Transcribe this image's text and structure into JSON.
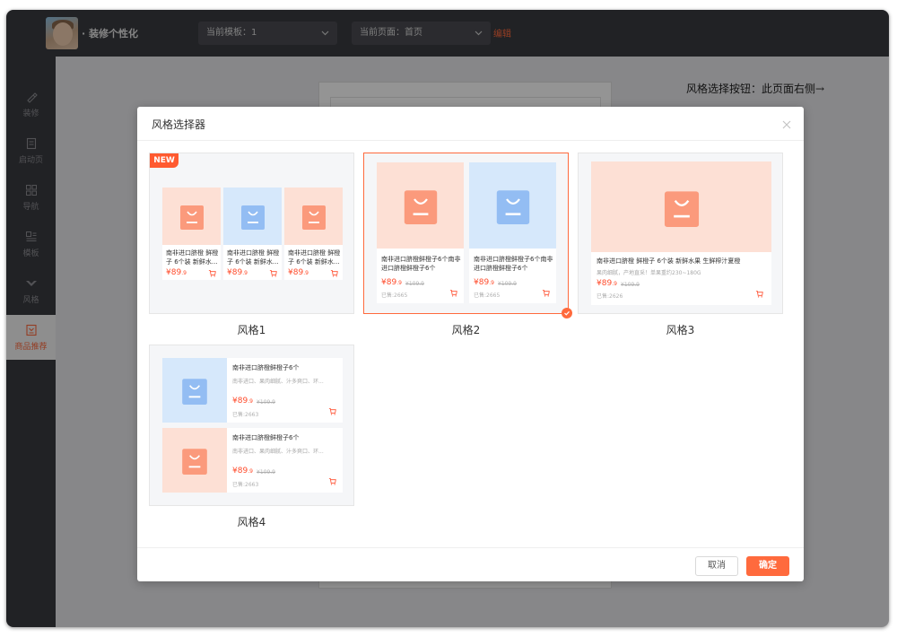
{
  "app": {
    "title": "· 装修个性化",
    "template_dropdown": "当前模板：1",
    "page_dropdown": "当前页面：首页",
    "edit_link": "编辑"
  },
  "sidebar": {
    "items": [
      {
        "label": "装修",
        "icon": "brush-icon"
      },
      {
        "label": "启动页",
        "icon": "document-icon"
      },
      {
        "label": "导航",
        "icon": "grid-icon"
      },
      {
        "label": "模板",
        "icon": "template-icon"
      },
      {
        "label": "风格",
        "icon": "style-icon"
      },
      {
        "label": "商品推荐",
        "icon": "recommend-icon",
        "active": true
      }
    ]
  },
  "hint_text": "风格选择按钮：此页面右侧→",
  "modal": {
    "title": "风格选择器",
    "cancel_label": "取消",
    "ok_label": "确定",
    "new_badge": "NEW",
    "styles": [
      {
        "label": "风格1"
      },
      {
        "label": "风格2",
        "selected": true
      },
      {
        "label": "风格3"
      },
      {
        "label": "风格4"
      }
    ]
  },
  "products": {
    "s1_name": "南非进口脐橙 鲜橙子 6个装 新鲜水...",
    "s2_name": "南非进口脐橙鲜橙子6个南非进口脐橙鲜橙子6个",
    "s3_name": "南非进口脐橙 鲜橙子 6个装 新鲜水果 生鲜榨汁夏橙",
    "s3_desc": "果肉细腻，产地直采！单果重约230~180G",
    "s4_name": "南非进口脐橙鲜橙子6个",
    "s4_desc": "南非进口、果肉细腻、汁多爽口、环...",
    "price_main": "¥89",
    "price_dec": ".9",
    "old_price": "¥109.9",
    "sold_2665": "已售:2665",
    "sold_2626": "已售:2626",
    "sold_2663": "已售:2663"
  },
  "colors": {
    "accent": "#ff6a3d",
    "topbar": "#3a3b40",
    "price": "#ff4b2b"
  }
}
